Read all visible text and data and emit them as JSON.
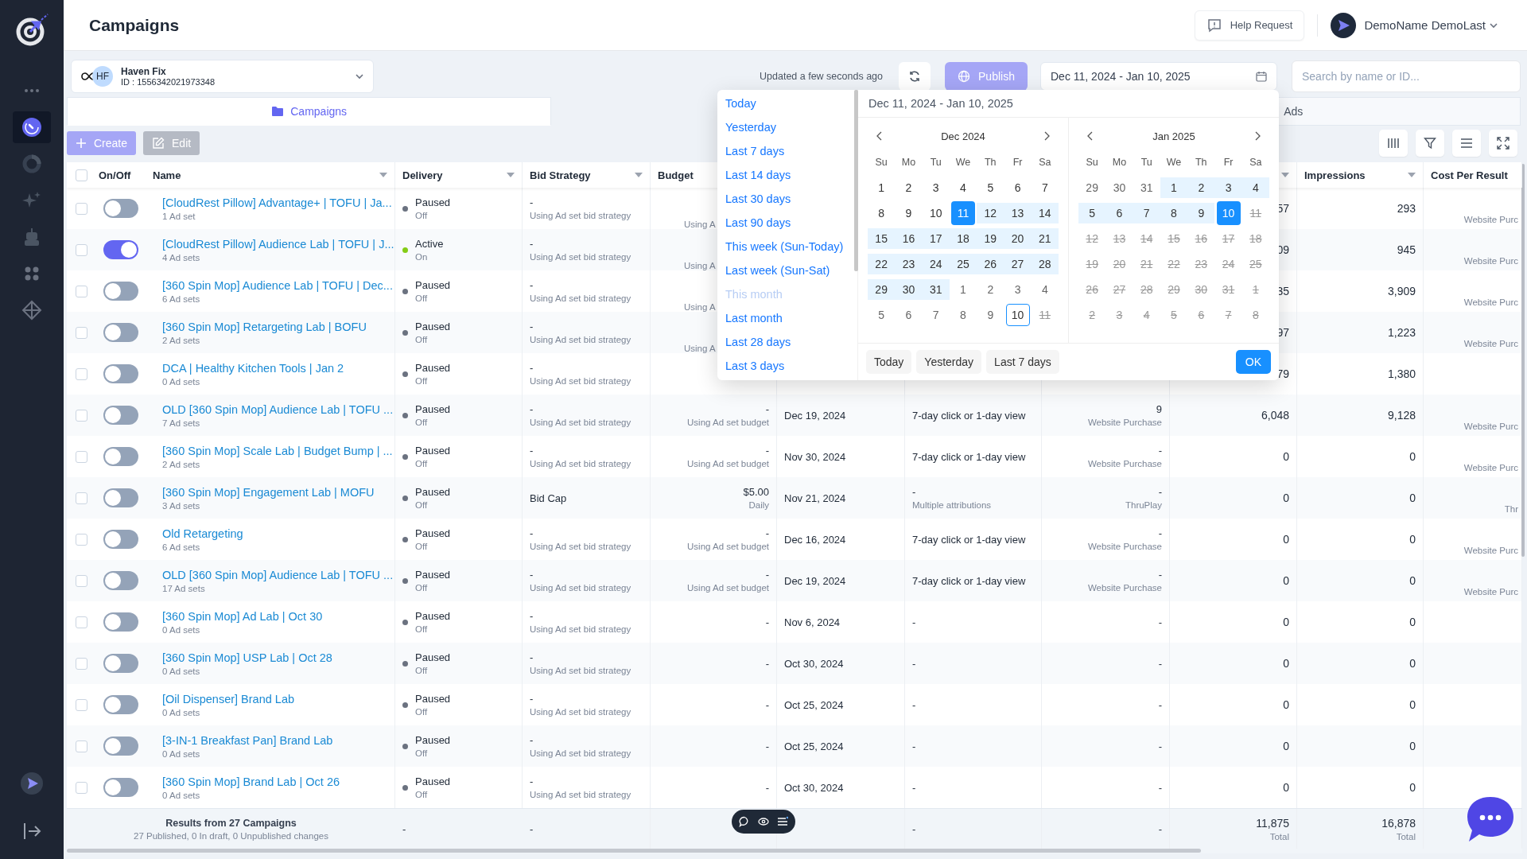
{
  "sidebar": {
    "items": [
      {
        "kind": "more",
        "selected": false
      },
      {
        "kind": "gauge",
        "selected": true
      },
      {
        "kind": "donut",
        "selected": false
      },
      {
        "kind": "sparkles",
        "selected": false
      },
      {
        "kind": "robot",
        "selected": false
      },
      {
        "kind": "grid",
        "selected": false
      },
      {
        "kind": "nodes",
        "selected": false
      }
    ]
  },
  "header": {
    "title": "Campaigns",
    "help_button": "Help Request",
    "user": "DemoName DemoLast"
  },
  "account": {
    "initials": "HF",
    "name": "Haven Fix",
    "id": "ID : 1556342021973348"
  },
  "toolbar": {
    "updated": "Updated a few seconds ago",
    "publish": {
      "label": "Publish",
      "disabled": true
    },
    "date_range": "Dec 11, 2024 - Jan 10, 2025",
    "search": {
      "placeholder": "Search by name or ID..."
    }
  },
  "tabs": [
    {
      "label": "Campaigns",
      "selected": true
    },
    {
      "label": "Ads",
      "selected": false
    }
  ],
  "actions": [
    {
      "label": "Create",
      "kind": "create",
      "disabled": true
    },
    {
      "label": "Edit",
      "kind": "edit",
      "disabled": true
    }
  ],
  "table": {
    "select_all": {
      "checked": false
    },
    "columns": [
      {
        "label": "On/Off",
        "sortable": false
      },
      {
        "label": "Name",
        "sortable": true
      },
      {
        "label": "Delivery",
        "sortable": true
      },
      {
        "label": "Bid Strategy",
        "sortable": true
      },
      {
        "label": "Budget"
      },
      {},
      {},
      {},
      {
        "sortable": true
      },
      {
        "label": "Impressions",
        "sortable": true
      },
      {
        "label": "Cost Per Result",
        "sortable": false
      }
    ],
    "rows": [
      {
        "checked": false,
        "on": false,
        "name": "[CloudRest Pillow] Advantage+ | TOFU | Ja...",
        "ad_sets": "1 Ad set",
        "delivery": {
          "main": "Paused",
          "sub": "Off"
        },
        "bid_strategy": {
          "main": "-",
          "sub": "Using Ad set bid strategy"
        },
        "budget": {
          "sub": "Using A"
        },
        "column_10": "57",
        "impressions": "293",
        "cost_per_result": "Website Purc"
      },
      {
        "checked": false,
        "on": true,
        "name": "[CloudRest Pillow] Audience Lab | TOFU | J...",
        "ad_sets": "4 Ad sets",
        "delivery": {
          "main": "Active",
          "sub": "On"
        },
        "bid_strategy": {
          "main": "-",
          "sub": "Using Ad set bid strategy"
        },
        "budget": {
          "sub": "Using A"
        },
        "column_10": "09",
        "impressions": "945",
        "cost_per_result": "Website Purc"
      },
      {
        "checked": false,
        "on": false,
        "name": "[360 Spin Mop] Audience Lab | TOFU | Dec...",
        "ad_sets": "6 Ad sets",
        "delivery": {
          "main": "Paused",
          "sub": "Off"
        },
        "bid_strategy": {
          "main": "-",
          "sub": "Using Ad set bid strategy"
        },
        "budget": {
          "sub": "Using A"
        },
        "column_10": "35",
        "impressions": "3,909",
        "cost_per_result": "Website Purc"
      },
      {
        "checked": false,
        "on": false,
        "name": "[360 Spin Mop] Retargeting Lab | BOFU",
        "ad_sets": "2 Ad sets",
        "delivery": {
          "main": "Paused",
          "sub": "Off"
        },
        "bid_strategy": {
          "main": "-",
          "sub": "Using Ad set bid strategy"
        },
        "budget": {
          "sub": "Using A"
        },
        "column_10": "97",
        "impressions": "1,223",
        "cost_per_result": "Website Purc"
      },
      {
        "checked": false,
        "on": false,
        "name": "DCA | Healthy Kitchen Tools | Jan 2",
        "ad_sets": "0 Ad sets",
        "delivery": {
          "main": "Paused",
          "sub": "Off"
        },
        "bid_strategy": {
          "main": "-",
          "sub": "Using Ad set bid strategy"
        },
        "column_10": "79",
        "impressions": "1,380"
      },
      {
        "checked": false,
        "on": false,
        "name": "OLD [360 Spin Mop] Audience Lab | TOFU ...",
        "ad_sets": "7 Ad sets",
        "delivery": {
          "main": "Paused",
          "sub": "Off"
        },
        "bid_strategy": {
          "main": "-",
          "sub": "Using Ad set bid strategy"
        },
        "budget": {
          "main": "-",
          "sub": "Using Ad set budget"
        },
        "column_7": "Dec 19, 2024",
        "column_8": {
          "main": "7-day click or 1-day view"
        },
        "column_9": {
          "main": "9",
          "sub": "Website Purchase"
        },
        "column_10": "6,048",
        "impressions": "9,128",
        "cost_per_result": "Website Purc"
      },
      {
        "checked": false,
        "on": false,
        "name": "[360 Spin Mop] Scale Lab | Budget Bump | ...",
        "ad_sets": "2 Ad sets",
        "delivery": {
          "main": "Paused",
          "sub": "Off"
        },
        "bid_strategy": {
          "main": "-",
          "sub": "Using Ad set bid strategy"
        },
        "budget": {
          "main": "-",
          "sub": "Using Ad set budget"
        },
        "column_7": "Nov 30, 2024",
        "column_8": {
          "main": "7-day click or 1-day view"
        },
        "column_9": {
          "main": "-",
          "sub": "Website Purchase"
        },
        "column_10": "0",
        "impressions": "0",
        "cost_per_result": "Website Purc"
      },
      {
        "checked": false,
        "on": false,
        "name": "[360 Spin Mop] Engagement Lab | MOFU",
        "ad_sets": "3 Ad sets",
        "delivery": {
          "main": "Paused",
          "sub": "Off"
        },
        "bid_strategy": {
          "main": "Bid Cap"
        },
        "budget": {
          "main": "$5.00",
          "sub": "Daily"
        },
        "column_7": "Nov 21, 2024",
        "column_8": {
          "main": "-",
          "sub": "Multiple attributions"
        },
        "column_9": {
          "main": "-",
          "sub": "ThruPlay"
        },
        "column_10": "0",
        "impressions": "0",
        "cost_per_result": "Thr"
      },
      {
        "checked": false,
        "on": false,
        "name": "Old Retargeting",
        "ad_sets": "6 Ad sets",
        "delivery": {
          "main": "Paused",
          "sub": "Off"
        },
        "bid_strategy": {
          "main": "-",
          "sub": "Using Ad set bid strategy"
        },
        "budget": {
          "main": "-",
          "sub": "Using Ad set budget"
        },
        "column_7": "Dec 16, 2024",
        "column_8": {
          "main": "7-day click or 1-day view"
        },
        "column_9": {
          "main": "-",
          "sub": "Website Purchase"
        },
        "column_10": "0",
        "impressions": "0",
        "cost_per_result": "Website Purc"
      },
      {
        "checked": false,
        "on": false,
        "name": "OLD [360 Spin Mop] Audience Lab | TOFU ...",
        "ad_sets": "17 Ad sets",
        "delivery": {
          "main": "Paused",
          "sub": "Off"
        },
        "bid_strategy": {
          "main": "-",
          "sub": "Using Ad set bid strategy"
        },
        "budget": {
          "main": "-",
          "sub": "Using Ad set budget"
        },
        "column_7": "Dec 19, 2024",
        "column_8": {
          "main": "7-day click or 1-day view"
        },
        "column_9": {
          "main": "-",
          "sub": "Website Purchase"
        },
        "column_10": "0",
        "impressions": "0",
        "cost_per_result": "Website Purc"
      },
      {
        "checked": false,
        "on": false,
        "name": "[360 Spin Mop] Ad Lab | Oct 30",
        "ad_sets": "0 Ad sets",
        "delivery": {
          "main": "Paused",
          "sub": "Off"
        },
        "bid_strategy": {
          "main": "-",
          "sub": "Using Ad set bid strategy"
        },
        "budget": {
          "main": "-"
        },
        "column_7": "Nov 6, 2024",
        "column_8": {
          "main": "-"
        },
        "column_9": {
          "main": "-"
        },
        "column_10": "0",
        "impressions": "0"
      },
      {
        "checked": false,
        "on": false,
        "name": "[360 Spin Mop] USP Lab | Oct 28",
        "ad_sets": "0 Ad sets",
        "delivery": {
          "main": "Paused",
          "sub": "Off"
        },
        "bid_strategy": {
          "main": "-",
          "sub": "Using Ad set bid strategy"
        },
        "budget": {
          "main": "-"
        },
        "column_7": "Oct 30, 2024",
        "column_8": {
          "main": "-"
        },
        "column_9": {
          "main": "-"
        },
        "column_10": "0",
        "impressions": "0"
      },
      {
        "checked": false,
        "on": false,
        "name": "[Oil Dispenser] Brand Lab",
        "ad_sets": "0 Ad sets",
        "delivery": {
          "main": "Paused",
          "sub": "Off"
        },
        "bid_strategy": {
          "main": "-",
          "sub": "Using Ad set bid strategy"
        },
        "budget": {
          "main": "-"
        },
        "column_7": "Oct 25, 2024",
        "column_8": {
          "main": "-"
        },
        "column_9": {
          "main": "-"
        },
        "column_10": "0",
        "impressions": "0"
      },
      {
        "checked": false,
        "on": false,
        "name": "[3-IN-1 Breakfast Pan] Brand Lab",
        "ad_sets": "0 Ad sets",
        "delivery": {
          "main": "Paused",
          "sub": "Off"
        },
        "bid_strategy": {
          "main": "-",
          "sub": "Using Ad set bid strategy"
        },
        "budget": {
          "main": "-"
        },
        "column_7": "Oct 25, 2024",
        "column_8": {
          "main": "-"
        },
        "column_9": {
          "main": "-"
        },
        "column_10": "0",
        "impressions": "0"
      },
      {
        "checked": false,
        "on": false,
        "name": "[360 Spin Mop] Brand Lab | Oct 26",
        "ad_sets": "0 Ad sets",
        "delivery": {
          "main": "Paused",
          "sub": "Off"
        },
        "bid_strategy": {
          "main": "-",
          "sub": "Using Ad set bid strategy"
        },
        "budget": {
          "main": "-"
        },
        "column_7": "Oct 30, 2024",
        "column_8": {
          "main": "-"
        },
        "column_9": {
          "main": "-"
        },
        "column_10": "0",
        "impressions": "0"
      }
    ],
    "footer": {
      "title": "Results from 27 Campaigns",
      "subtitle": "27 Published, 0 In draft, 0 Unpublished changes",
      "delivery": "-",
      "bid_strategy": "-",
      "column_8": "-",
      "column_9": "-",
      "column_10": {
        "main": "11,875",
        "sub": "Total"
      },
      "impressions": {
        "main": "16,878",
        "sub": "Total"
      }
    }
  },
  "date_picker": {
    "presets": [
      {
        "label": "Today",
        "disabled": false
      },
      {
        "label": "Yesterday",
        "disabled": false
      },
      {
        "label": "Last 7 days",
        "disabled": false
      },
      {
        "label": "Last 14 days",
        "disabled": false
      },
      {
        "label": "Last 30 days",
        "disabled": false
      },
      {
        "label": "Last 90 days",
        "disabled": false
      },
      {
        "label": "This week (Sun-Today)",
        "disabled": false
      },
      {
        "label": "Last week (Sun-Sat)",
        "disabled": false
      },
      {
        "label": "This month",
        "disabled": true
      },
      {
        "label": "Last month",
        "disabled": false
      },
      {
        "label": "Last 28 days",
        "disabled": false
      },
      {
        "label": "Last 3 days",
        "disabled": false
      }
    ],
    "range": "Dec 11, 2024 - Jan 10, 2025",
    "months": [
      {
        "title": "Dec 2024",
        "weekdays": [
          "Su",
          "Mo",
          "Tu",
          "We",
          "Th",
          "Fr",
          "Sa"
        ],
        "weeks": [
          [
            {
              "d": "1",
              "kind": "day"
            },
            {
              "d": "2",
              "kind": "day"
            },
            {
              "d": "3",
              "kind": "day"
            },
            {
              "d": "4",
              "kind": "day"
            },
            {
              "d": "5",
              "kind": "day"
            },
            {
              "d": "6",
              "kind": "day"
            },
            {
              "d": "7",
              "kind": "day"
            }
          ],
          [
            {
              "d": "8",
              "kind": "day"
            },
            {
              "d": "9",
              "kind": "day"
            },
            {
              "d": "10",
              "kind": "day"
            },
            {
              "d": "11",
              "kind": "edge"
            },
            {
              "d": "12",
              "kind": "range"
            },
            {
              "d": "13",
              "kind": "range"
            },
            {
              "d": "14",
              "kind": "range"
            }
          ],
          [
            {
              "d": "15",
              "kind": "range"
            },
            {
              "d": "16",
              "kind": "range"
            },
            {
              "d": "17",
              "kind": "range"
            },
            {
              "d": "18",
              "kind": "range"
            },
            {
              "d": "19",
              "kind": "range"
            },
            {
              "d": "20",
              "kind": "range"
            },
            {
              "d": "21",
              "kind": "range"
            }
          ],
          [
            {
              "d": "22",
              "kind": "range"
            },
            {
              "d": "23",
              "kind": "range"
            },
            {
              "d": "24",
              "kind": "range"
            },
            {
              "d": "25",
              "kind": "range"
            },
            {
              "d": "26",
              "kind": "range"
            },
            {
              "d": "27",
              "kind": "range"
            },
            {
              "d": "28",
              "kind": "range"
            }
          ],
          [
            {
              "d": "29",
              "kind": "range"
            },
            {
              "d": "30",
              "kind": "range"
            },
            {
              "d": "31",
              "kind": "range"
            },
            {
              "d": "1",
              "kind": "other"
            },
            {
              "d": "2",
              "kind": "other"
            },
            {
              "d": "3",
              "kind": "other"
            },
            {
              "d": "4",
              "kind": "other"
            }
          ],
          [
            {
              "d": "5",
              "kind": "other"
            },
            {
              "d": "6",
              "kind": "other"
            },
            {
              "d": "7",
              "kind": "other"
            },
            {
              "d": "8",
              "kind": "other"
            },
            {
              "d": "9",
              "kind": "other"
            },
            {
              "d": "10",
              "kind": "today"
            },
            {
              "d": "11",
              "kind": "off"
            }
          ]
        ]
      },
      {
        "title": "Jan 2025",
        "weekdays": [
          "Su",
          "Mo",
          "Tu",
          "We",
          "Th",
          "Fr",
          "Sa"
        ],
        "weeks": [
          [
            {
              "d": "29",
              "kind": "other"
            },
            {
              "d": "30",
              "kind": "other"
            },
            {
              "d": "31",
              "kind": "other"
            },
            {
              "d": "1",
              "kind": "range"
            },
            {
              "d": "2",
              "kind": "range"
            },
            {
              "d": "3",
              "kind": "range"
            },
            {
              "d": "4",
              "kind": "range"
            }
          ],
          [
            {
              "d": "5",
              "kind": "range"
            },
            {
              "d": "6",
              "kind": "range"
            },
            {
              "d": "7",
              "kind": "range"
            },
            {
              "d": "8",
              "kind": "range"
            },
            {
              "d": "9",
              "kind": "range"
            },
            {
              "d": "10",
              "kind": "edge"
            },
            {
              "d": "11",
              "kind": "off"
            }
          ],
          [
            {
              "d": "12",
              "kind": "off"
            },
            {
              "d": "13",
              "kind": "off"
            },
            {
              "d": "14",
              "kind": "off"
            },
            {
              "d": "15",
              "kind": "off"
            },
            {
              "d": "16",
              "kind": "off"
            },
            {
              "d": "17",
              "kind": "off"
            },
            {
              "d": "18",
              "kind": "off"
            }
          ],
          [
            {
              "d": "19",
              "kind": "off"
            },
            {
              "d": "20",
              "kind": "off"
            },
            {
              "d": "21",
              "kind": "off"
            },
            {
              "d": "22",
              "kind": "off"
            },
            {
              "d": "23",
              "kind": "off"
            },
            {
              "d": "24",
              "kind": "off"
            },
            {
              "d": "25",
              "kind": "off"
            }
          ],
          [
            {
              "d": "26",
              "kind": "off"
            },
            {
              "d": "27",
              "kind": "off"
            },
            {
              "d": "28",
              "kind": "off"
            },
            {
              "d": "29",
              "kind": "off"
            },
            {
              "d": "30",
              "kind": "off"
            },
            {
              "d": "31",
              "kind": "off"
            },
            {
              "d": "1",
              "kind": "off"
            }
          ],
          [
            {
              "d": "2",
              "kind": "off"
            },
            {
              "d": "3",
              "kind": "off"
            },
            {
              "d": "4",
              "kind": "off"
            },
            {
              "d": "5",
              "kind": "off"
            },
            {
              "d": "6",
              "kind": "off"
            },
            {
              "d": "7",
              "kind": "off"
            },
            {
              "d": "8",
              "kind": "off"
            }
          ]
        ]
      }
    ],
    "quick": [
      "Today",
      "Yesterday",
      "Last 7 days"
    ],
    "ok": "OK"
  }
}
